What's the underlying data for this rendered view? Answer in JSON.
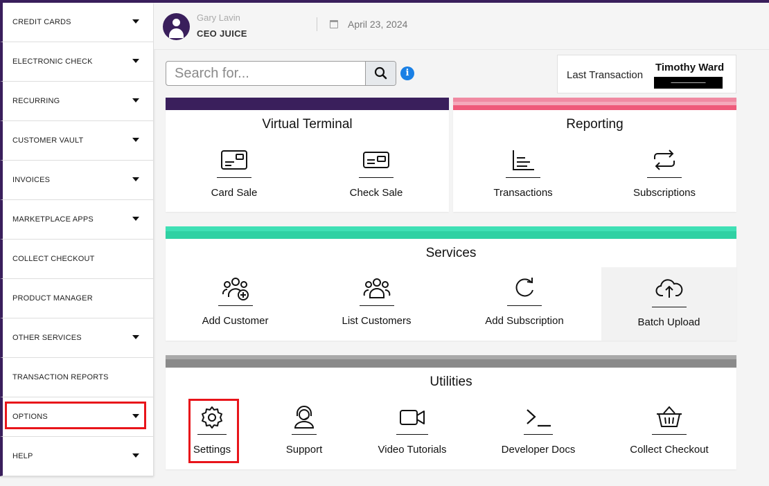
{
  "sidebar": {
    "items": [
      {
        "label": "CREDIT CARDS",
        "has_caret": true
      },
      {
        "label": "ELECTRONIC CHECK",
        "has_caret": true
      },
      {
        "label": "RECURRING",
        "has_caret": true
      },
      {
        "label": "CUSTOMER VAULT",
        "has_caret": true
      },
      {
        "label": "INVOICES",
        "has_caret": true
      },
      {
        "label": "MARKETPLACE APPS",
        "has_caret": true
      },
      {
        "label": "COLLECT CHECKOUT",
        "has_caret": false
      },
      {
        "label": "PRODUCT MANAGER",
        "has_caret": false
      },
      {
        "label": "OTHER SERVICES",
        "has_caret": true
      },
      {
        "label": "TRANSACTION REPORTS",
        "has_caret": false
      },
      {
        "label": "OPTIONS",
        "has_caret": true
      },
      {
        "label": "HELP",
        "has_caret": true
      }
    ]
  },
  "header": {
    "user_name": "Gary Lavin",
    "company": "CEO JUICE",
    "date": "April 23, 2024"
  },
  "search": {
    "placeholder": "Search for..."
  },
  "last_transaction": {
    "label": "Last Transaction",
    "name": "Timothy Ward",
    "amount": "—————"
  },
  "virtual_terminal": {
    "title": "Virtual Terminal",
    "bar_color": "#3a1f5c",
    "tiles": [
      {
        "label": "Card Sale",
        "icon": "card-sale-icon"
      },
      {
        "label": "Check Sale",
        "icon": "check-sale-icon"
      }
    ]
  },
  "reporting": {
    "title": "Reporting",
    "bar_color": "#ef5a7a",
    "tiles": [
      {
        "label": "Transactions",
        "icon": "transactions-icon"
      },
      {
        "label": "Subscriptions",
        "icon": "subscriptions-icon"
      }
    ]
  },
  "services": {
    "title": "Services",
    "bar_color": "#2fd1a3",
    "tiles": [
      {
        "label": "Add Customer",
        "icon": "add-customer-icon"
      },
      {
        "label": "List Customers",
        "icon": "list-customers-icon"
      },
      {
        "label": "Add Subscription",
        "icon": "add-subscription-icon"
      },
      {
        "label": "Batch Upload",
        "icon": "batch-upload-icon"
      }
    ]
  },
  "utilities": {
    "title": "Utilities",
    "bar_color": "#8a8a8a",
    "tiles": [
      {
        "label": "Settings",
        "icon": "settings-icon"
      },
      {
        "label": "Support",
        "icon": "support-icon"
      },
      {
        "label": "Video Tutorials",
        "icon": "video-tutorials-icon"
      },
      {
        "label": "Developer Docs",
        "icon": "developer-docs-icon"
      },
      {
        "label": "Collect Checkout",
        "icon": "collect-checkout-icon"
      }
    ]
  },
  "colors": {
    "brand_purple": "#3a1f5c",
    "highlight_red": "#e8141a",
    "info_blue": "#1a80e5"
  }
}
